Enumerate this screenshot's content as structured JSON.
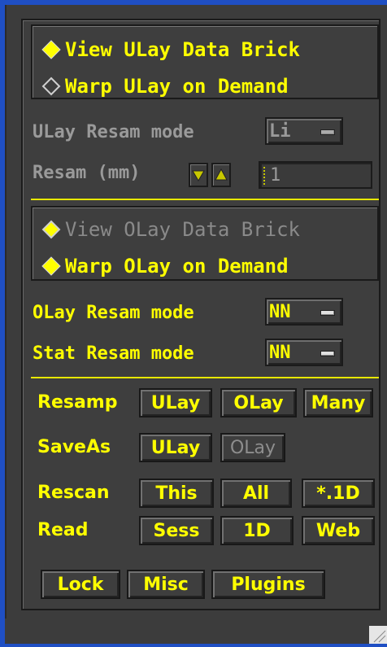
{
  "ulay_box": {
    "options": [
      {
        "label": "View ULay Data Brick",
        "selected": true
      },
      {
        "label": "Warp ULay on Demand",
        "selected": false
      }
    ]
  },
  "ulay_resam": {
    "label": "ULay Resam mode",
    "value": "Li"
  },
  "resam_mm": {
    "label": "Resam (mm)",
    "value": "1"
  },
  "olay_box": {
    "options": [
      {
        "label": "View OLay Data Brick",
        "selected": false
      },
      {
        "label": "Warp OLay on Demand",
        "selected": true
      }
    ]
  },
  "olay_resam": {
    "label": "OLay Resam mode",
    "value": "NN"
  },
  "stat_resam": {
    "label": "Stat Resam mode",
    "value": "NN"
  },
  "rows": {
    "resamp": {
      "label": "Resamp",
      "buttons": [
        "ULay",
        "OLay",
        "Many"
      ]
    },
    "saveas": {
      "label": "SaveAs",
      "buttons": [
        "ULay",
        "OLay"
      ]
    },
    "rescan": {
      "label": "Rescan",
      "buttons": [
        "This",
        "All",
        "*.1D"
      ]
    },
    "read": {
      "label": "Read",
      "buttons": [
        "Sess",
        "1D",
        "Web"
      ]
    }
  },
  "bottom_buttons": [
    "Lock",
    "Misc",
    "Plugins"
  ],
  "colors": {
    "accent": "#ffff00",
    "panel": "#3e3e3e",
    "frame": "#1f4fc4",
    "disabled": "#9a9a9a"
  }
}
